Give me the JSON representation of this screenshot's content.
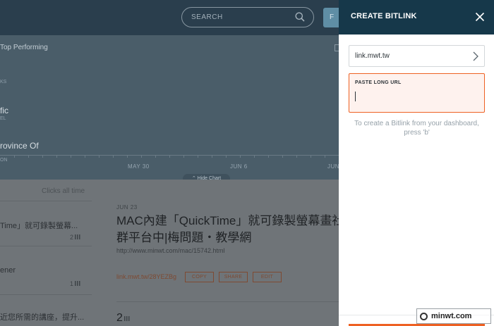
{
  "topbar": {
    "search_placeholder": "SEARCH",
    "action_button_label": "F"
  },
  "chart": {
    "top_performing": "Top Performing",
    "row1_sub": "KS",
    "row2_name": "fic",
    "row2_sub": "EL",
    "row3_name": "rovince Of",
    "row3_sub": "ON",
    "dates": [
      "MAY 30",
      "JUN 6",
      "JUN"
    ],
    "hide_chart": "⌃ Hide Chart"
  },
  "list": {
    "clicks_header": "Clicks all time",
    "items": [
      {
        "text": "Time」就可錄製螢幕...",
        "count": "2"
      },
      {
        "text": "ener",
        "count": "1"
      },
      {
        "text": "近您所需的講座，提升...",
        "count": "1"
      }
    ]
  },
  "detail": {
    "date": "JUN 23",
    "title": "MAC內建「QuickTime」就可錄製螢幕畫社群平台中|梅問題・教學網",
    "url": "http://www.minwt.com/mac/15742.html",
    "short_link": "link.mwt.tw/28YEZBg",
    "copy_label": "COPY",
    "share_label": "SHARE",
    "edit_label": "EDIT",
    "clicks_count": "2"
  },
  "drawer": {
    "title": "CREATE BITLINK",
    "domain_value": "link.mwt.tw",
    "long_url_label": "PASTE LONG URL",
    "long_url_value": "",
    "hint": "To create a Bitlink from your dashboard, press 'b'"
  },
  "watermark": {
    "text": "minwt.com"
  },
  "colors": {
    "drawer_header": "#16384a",
    "accent_orange": "#ee6123",
    "input_bg": "#fef2ee",
    "hint_text": "#96a1a9"
  }
}
